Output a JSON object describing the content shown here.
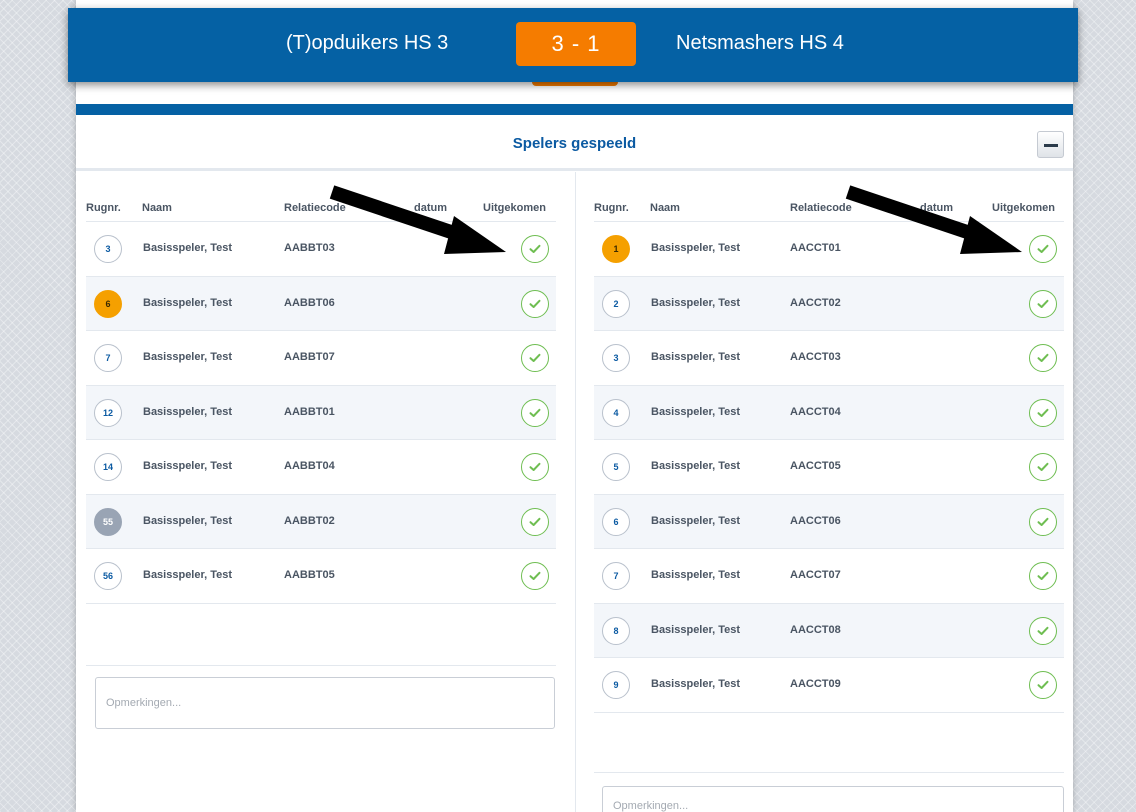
{
  "match": {
    "home_team": "(T)opduikers HS 3",
    "score": "3 - 1",
    "away_team": "Netsmashers HS 4"
  },
  "section": {
    "title": "Spelers gespeeld",
    "collapse_icon": "minus-icon"
  },
  "columns": {
    "number": "Rugnr.",
    "name": "Naam",
    "relation_code": "Relatiecode",
    "date": "datum",
    "outcome": "Uitgekomen"
  },
  "colors": {
    "brand_blue": "#0561a4",
    "score_orange": "#f57c00",
    "captain_orange": "#f5a000",
    "check_green": "#6fbe52"
  },
  "home_players": [
    {
      "number": "3",
      "name": "Basisspeler, Test",
      "code": "AABBT03",
      "badge": "default"
    },
    {
      "number": "6",
      "name": "Basisspeler, Test",
      "code": "AABBT06",
      "badge": "orange"
    },
    {
      "number": "7",
      "name": "Basisspeler, Test",
      "code": "AABBT07",
      "badge": "default"
    },
    {
      "number": "12",
      "name": "Basisspeler, Test",
      "code": "AABBT01",
      "badge": "default"
    },
    {
      "number": "14",
      "name": "Basisspeler, Test",
      "code": "AABBT04",
      "badge": "default"
    },
    {
      "number": "55",
      "name": "Basisspeler, Test",
      "code": "AABBT02",
      "badge": "gray"
    },
    {
      "number": "56",
      "name": "Basisspeler, Test",
      "code": "AABBT05",
      "badge": "default"
    }
  ],
  "away_players": [
    {
      "number": "1",
      "name": "Basisspeler, Test",
      "code": "AACCT01",
      "badge": "orange"
    },
    {
      "number": "2",
      "name": "Basisspeler, Test",
      "code": "AACCT02",
      "badge": "default"
    },
    {
      "number": "3",
      "name": "Basisspeler, Test",
      "code": "AACCT03",
      "badge": "default"
    },
    {
      "number": "4",
      "name": "Basisspeler, Test",
      "code": "AACCT04",
      "badge": "default"
    },
    {
      "number": "5",
      "name": "Basisspeler, Test",
      "code": "AACCT05",
      "badge": "default"
    },
    {
      "number": "6",
      "name": "Basisspeler, Test",
      "code": "AACCT06",
      "badge": "default"
    },
    {
      "number": "7",
      "name": "Basisspeler, Test",
      "code": "AACCT07",
      "badge": "default"
    },
    {
      "number": "8",
      "name": "Basisspeler, Test",
      "code": "AACCT08",
      "badge": "default"
    },
    {
      "number": "9",
      "name": "Basisspeler, Test",
      "code": "AACCT09",
      "badge": "default"
    }
  ],
  "remarks": {
    "placeholder": "Opmerkingen..."
  }
}
